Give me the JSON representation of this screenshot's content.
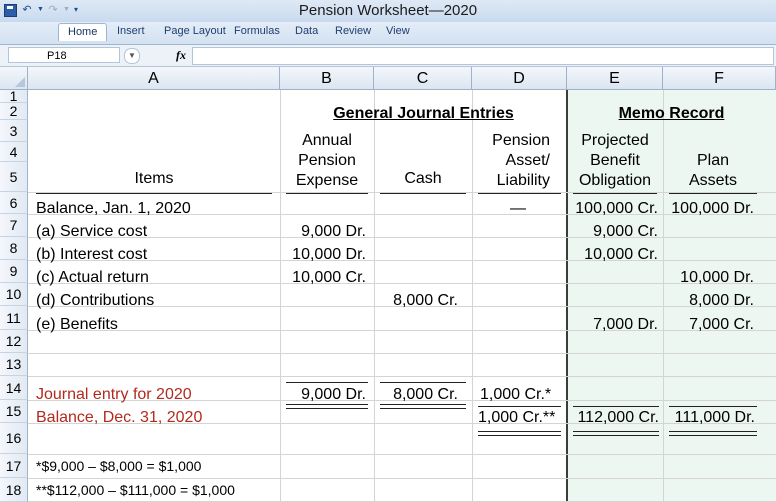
{
  "window": {
    "title": "Pension Worksheet—2020"
  },
  "ribbon": {
    "tabs": [
      "Home",
      "Insert",
      "Page Layout",
      "Formulas",
      "Data",
      "Review",
      "View"
    ]
  },
  "formula_bar": {
    "name_box": "P18",
    "fx_label": "fx",
    "content": ""
  },
  "columns": [
    "A",
    "B",
    "C",
    "D",
    "E",
    "F"
  ],
  "rows": [
    "1",
    "2",
    "3",
    "4",
    "5",
    "6",
    "7",
    "8",
    "9",
    "10",
    "11",
    "12",
    "13",
    "14",
    "15",
    "16",
    "17",
    "18"
  ],
  "sheet": {
    "general_journal_entries": "General Journal Entries",
    "memo_record": "Memo Record",
    "headers": {
      "items": "Items",
      "b1": "Annual",
      "b2": "Pension",
      "b3": "Expense",
      "c": "Cash",
      "d1": "Pension",
      "d2": "Asset/",
      "d3": "Liability",
      "e1": "Projected",
      "e2": "Benefit",
      "e3": "Obligation",
      "f1": "Plan",
      "f2": "Assets"
    },
    "r6": {
      "a": "Balance, Jan. 1, 2020",
      "d": "—",
      "e": "100,000 Cr.",
      "f": "100,000 Dr."
    },
    "r7": {
      "a": "(a) Service cost",
      "b": "9,000 Dr.",
      "e": "9,000 Cr."
    },
    "r8": {
      "a": "(b) Interest cost",
      "b": "10,000 Dr.",
      "e": "10,000 Cr."
    },
    "r9": {
      "a": "(c) Actual return",
      "b": "10,000 Cr.",
      "f": "10,000 Dr."
    },
    "r10": {
      "a": "(d) Contributions",
      "c": "8,000 Cr.",
      "f": "8,000 Dr."
    },
    "r11": {
      "a": "(e) Benefits",
      "e": "7,000 Dr.",
      "f": "7,000 Cr."
    },
    "r14": {
      "a": "Journal entry for 2020",
      "b": "9,000 Dr.",
      "c": "8,000 Cr.",
      "d": "1,000 Cr.*"
    },
    "r15": {
      "a": "Balance, Dec. 31, 2020",
      "d": "1,000 Cr.**",
      "e": "112,000 Cr.",
      "f": "111,000 Dr."
    },
    "r17": {
      "a": "*$9,000 – $8,000 = $1,000"
    },
    "r18": {
      "a": "**$112,000 – $111,000 = $1,000"
    }
  },
  "colors": {
    "red_text": "#b22a1d",
    "memo_background": "#ecf7f1",
    "header_blue": "#dbe5f1"
  }
}
